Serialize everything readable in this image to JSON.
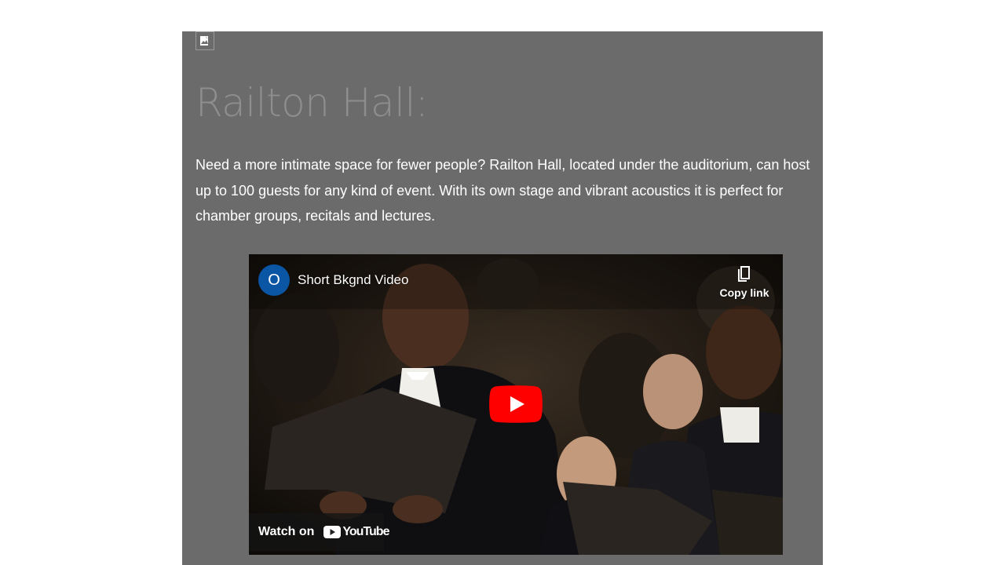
{
  "page": {
    "title": "Railton Hall:",
    "body": " Need a more intimate space for fewer people?  Railton Hall, located under the auditorium, can host up to 100 guests for any kind of event. With its own stage and vibrant acoustics it is perfect for chamber groups, recitals and lectures."
  },
  "icons": {
    "placeholder": "broken-image-icon"
  },
  "video": {
    "channel_initial": "O",
    "title": "Short Bkgnd Video",
    "copy_link_label": "Copy link",
    "watch_on_label": "Watch on",
    "platform": "YouTube"
  },
  "colors": {
    "panel_background": "#6b6b6b",
    "title_color": "#8e8e8e",
    "body_text": "#ffffff",
    "avatar": "#0a56a4",
    "play_button": "#ff0000"
  }
}
